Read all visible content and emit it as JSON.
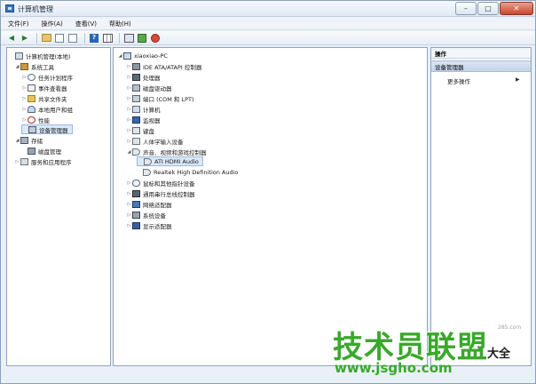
{
  "window": {
    "title": "计算机管理",
    "controls": {
      "minimize": "–",
      "maximize": "□",
      "close": "✕"
    }
  },
  "menu": [
    "文件(F)",
    "操作(A)",
    "查看(V)",
    "帮助(H)"
  ],
  "toolbar_icons": [
    "back-arrow-icon",
    "forward-arrow-icon",
    "up-folder-icon",
    "show-hide-tree-icon",
    "properties-icon",
    "help-icon",
    "view-icon",
    "scan-hardware-icon",
    "update-driver-icon",
    "uninstall-icon"
  ],
  "left_tree": [
    {
      "label": "计算机管理(本地)",
      "level": 0,
      "toggle": "",
      "icon": "computer-icon"
    },
    {
      "label": "系统工具",
      "level": 1,
      "toggle": "◢",
      "icon": "tools-icon"
    },
    {
      "label": "任务计划程序",
      "level": 2,
      "toggle": "▷",
      "icon": "clock-icon"
    },
    {
      "label": "事件查看器",
      "level": 2,
      "toggle": "▷",
      "icon": "event-log-icon"
    },
    {
      "label": "共享文件夹",
      "level": 2,
      "toggle": "▷",
      "icon": "shared-folder-icon"
    },
    {
      "label": "本地用户和组",
      "level": 2,
      "toggle": "▷",
      "icon": "users-icon"
    },
    {
      "label": "性能",
      "level": 2,
      "toggle": "▷",
      "icon": "performance-icon"
    },
    {
      "label": "设备管理器",
      "level": 2,
      "toggle": "",
      "icon": "device-manager-icon",
      "selected": true
    },
    {
      "label": "存储",
      "level": 1,
      "toggle": "◢",
      "icon": "storage-icon"
    },
    {
      "label": "磁盘管理",
      "level": 2,
      "toggle": "",
      "icon": "disk-icon"
    },
    {
      "label": "服务和应用程序",
      "level": 1,
      "toggle": "▷",
      "icon": "services-icon"
    }
  ],
  "device_tree": [
    {
      "label": "xiaoxiao-PC",
      "level": 0,
      "toggle": "◢",
      "icon": "pc-icon"
    },
    {
      "label": "IDE ATA/ATAPI 控制器",
      "level": 1,
      "toggle": "▷",
      "icon": "ide-controller-icon"
    },
    {
      "label": "处理器",
      "level": 1,
      "toggle": "▷",
      "icon": "processor-icon"
    },
    {
      "label": "磁盘驱动器",
      "level": 1,
      "toggle": "▷",
      "icon": "disk-drive-icon"
    },
    {
      "label": "端口 (COM 和 LPT)",
      "level": 1,
      "toggle": "▷",
      "icon": "port-icon"
    },
    {
      "label": "计算机",
      "level": 1,
      "toggle": "▷",
      "icon": "computer-icon"
    },
    {
      "label": "监视器",
      "level": 1,
      "toggle": "▷",
      "icon": "monitor-icon"
    },
    {
      "label": "键盘",
      "level": 1,
      "toggle": "▷",
      "icon": "keyboard-icon"
    },
    {
      "label": "人体学输入设备",
      "level": 1,
      "toggle": "▷",
      "icon": "hid-icon"
    },
    {
      "label": "声音、视频和游戏控制器",
      "level": 1,
      "toggle": "◢",
      "icon": "audio-icon"
    },
    {
      "label": "ATI HDMI Audio",
      "level": 2,
      "toggle": "",
      "icon": "audio-icon",
      "selected": true
    },
    {
      "label": "Realtek High Definition Audio",
      "level": 2,
      "toggle": "",
      "icon": "audio-icon"
    },
    {
      "label": "鼠标和其他指针设备",
      "level": 1,
      "toggle": "▷",
      "icon": "mouse-icon"
    },
    {
      "label": "通用串行总线控制器",
      "level": 1,
      "toggle": "▷",
      "icon": "usb-icon"
    },
    {
      "label": "网络适配器",
      "level": 1,
      "toggle": "▷",
      "icon": "network-adapter-icon"
    },
    {
      "label": "系统设备",
      "level": 1,
      "toggle": "▷",
      "icon": "system-device-icon"
    },
    {
      "label": "显示适配器",
      "level": 1,
      "toggle": "▷",
      "icon": "display-adapter-icon"
    }
  ],
  "actions": {
    "title": "操作",
    "section": "设备管理器",
    "more": "更多操作",
    "more_arrow": "▶"
  },
  "watermark": {
    "main": "技术员联盟",
    "url": "www.jsgho.com",
    "side": "大全",
    "faint": "285.com"
  },
  "colors": {
    "selection": "#dbe8f8",
    "watermark_green": "#3aa82b",
    "frame": "#e9f0f8"
  }
}
